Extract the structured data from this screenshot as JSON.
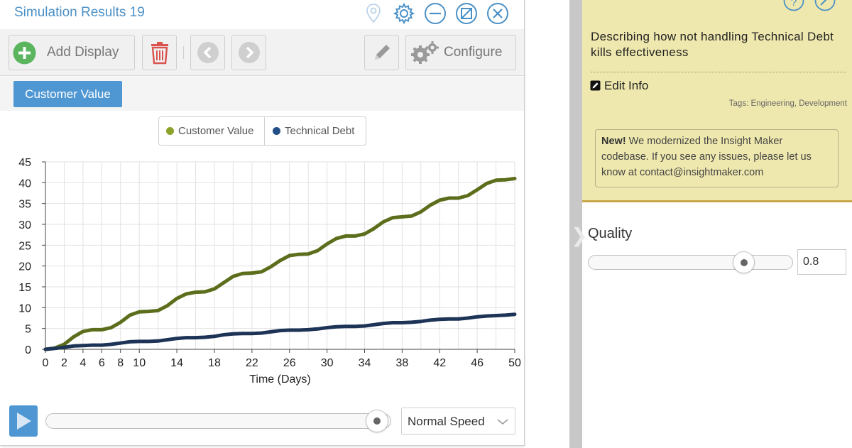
{
  "window": {
    "title": "Simulation Results 19",
    "icons": [
      "map-pin-icon",
      "gear-icon",
      "minimize-icon",
      "restore-icon",
      "close-icon"
    ]
  },
  "toolbar": {
    "add_display_label": "Add Display",
    "configure_label": "Configure"
  },
  "tabs": [
    {
      "label": "Customer Value",
      "active": true
    }
  ],
  "legend": [
    {
      "label": "Customer Value",
      "color": "#8ba32a"
    },
    {
      "label": "Technical Debt",
      "color": "#244e87"
    }
  ],
  "chart_data": {
    "type": "line",
    "xlabel": "Time (Days)",
    "ylabel": "",
    "xlim": [
      0,
      50
    ],
    "ylim": [
      0,
      45
    ],
    "grid": true,
    "x_ticks": [
      0,
      2,
      4,
      6,
      8,
      10,
      14,
      18,
      22,
      26,
      30,
      34,
      38,
      42,
      46,
      50
    ],
    "y_ticks": [
      0,
      5,
      10,
      15,
      20,
      25,
      30,
      35,
      40,
      45
    ],
    "x": [
      0,
      1,
      2,
      3,
      4,
      5,
      6,
      7,
      8,
      9,
      10,
      11,
      12,
      13,
      14,
      15,
      16,
      17,
      18,
      19,
      20,
      21,
      22,
      23,
      24,
      25,
      26,
      27,
      28,
      29,
      30,
      31,
      32,
      33,
      34,
      35,
      36,
      37,
      38,
      39,
      40,
      41,
      42,
      43,
      44,
      45,
      46,
      47,
      48,
      49,
      50
    ],
    "series": [
      {
        "name": "Customer Value",
        "color": "#5c6e1c",
        "values": [
          0,
          0.3,
          1.2,
          3.0,
          4.3,
          4.7,
          4.7,
          5.2,
          6.5,
          8.2,
          9.0,
          9.1,
          9.3,
          10.5,
          12.2,
          13.3,
          13.7,
          13.8,
          14.5,
          16.0,
          17.5,
          18.2,
          18.3,
          18.6,
          19.8,
          21.3,
          22.5,
          22.8,
          22.9,
          23.7,
          25.3,
          26.6,
          27.2,
          27.2,
          27.7,
          29.0,
          30.6,
          31.6,
          31.8,
          32.0,
          33.0,
          34.6,
          35.8,
          36.3,
          36.3,
          36.9,
          38.3,
          39.8,
          40.6,
          40.7,
          41.0
        ]
      },
      {
        "name": "Technical Debt",
        "color": "#1d3457",
        "values": [
          0,
          0.2,
          0.5,
          0.8,
          0.9,
          1.0,
          1.0,
          1.2,
          1.5,
          1.8,
          1.9,
          1.9,
          2.0,
          2.3,
          2.6,
          2.8,
          2.8,
          2.9,
          3.1,
          3.5,
          3.7,
          3.8,
          3.8,
          3.9,
          4.2,
          4.5,
          4.6,
          4.6,
          4.7,
          4.9,
          5.2,
          5.4,
          5.5,
          5.5,
          5.6,
          5.9,
          6.2,
          6.4,
          6.4,
          6.5,
          6.7,
          7.0,
          7.2,
          7.3,
          7.3,
          7.5,
          7.8,
          8.0,
          8.1,
          8.2,
          8.4
        ]
      }
    ]
  },
  "playback": {
    "progress": 1.0,
    "speed_label": "Normal Speed"
  },
  "info": {
    "title": "Describing how not handling Technical Debt kills effectiveness",
    "edit_label": "Edit Info",
    "tags": "Tags: Engineering, Development",
    "notice_new": "New!",
    "notice_text": " We modernized the Insight Maker codebase. If you see any issues, please let us know at contact@insightmaker.com"
  },
  "quality": {
    "label": "Quality",
    "value": "0.8",
    "slider_level": 0.8
  },
  "splitter": {
    "arrow": "❯"
  }
}
